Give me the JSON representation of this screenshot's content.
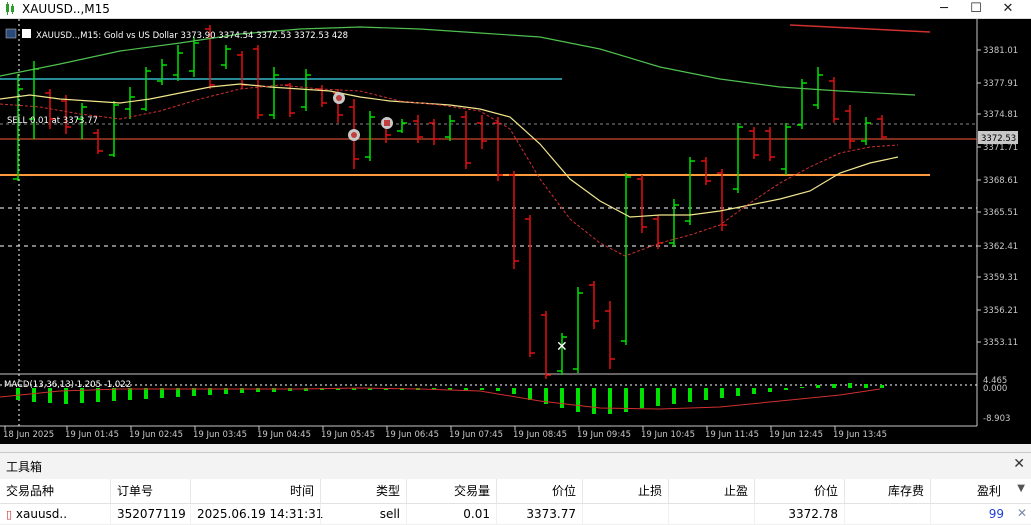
{
  "window": {
    "title": "XAUUSD..,M15",
    "min_icon": "minimize-icon",
    "max_icon": "maximize-icon",
    "close_icon": "close-icon"
  },
  "chart": {
    "info_line": "XAUUSD..,M15:  Gold vs US Dollar  3373.90 3374.54 3372.53 3372.53  428",
    "order_label": "SELL 0.01 at 3373.77",
    "macd_label": "MACD(13,36,13) 1.205 -1.022",
    "bid_price_tag": "3372.53",
    "price_ticks": [
      "3381.01",
      "3377.91",
      "3374.81",
      "3371.71",
      "3368.61",
      "3365.51",
      "3362.41",
      "3359.31",
      "3356.21",
      "3353.11"
    ],
    "macd_ticks": [
      "4.465",
      "0.000",
      "-8.903"
    ],
    "time_ticks": [
      "18 Jun 2025",
      "19 Jun 01:45",
      "19 Jun 02:45",
      "19 Jun 03:45",
      "19 Jun 04:45",
      "19 Jun 05:45",
      "19 Jun 06:45",
      "19 Jun 07:45",
      "19 Jun 08:45",
      "19 Jun 09:45",
      "19 Jun 10:45",
      "19 Jun 11:45",
      "19 Jun 12:45",
      "19 Jun 13:45"
    ],
    "colors": {
      "bull": "#00e000",
      "bear": "#e01010",
      "bg": "#000000",
      "axis": "#c8c8c8",
      "ma_yellow": "#f0e68c",
      "ma_green": "#4fc04f",
      "ma_red": "#d03030",
      "hline_orange": "#ff9a3c",
      "hline_cyan": "#34b8c8"
    }
  },
  "toolbox": {
    "title": "工具箱",
    "close_label": "✕",
    "columns": [
      "交易品种",
      "订单号",
      "时间",
      "类型",
      "交易量",
      "价位",
      "止损",
      "止盈",
      "价位",
      "库存费",
      "盈利"
    ],
    "rows": [
      {
        "symbol": "xauusd..",
        "order": "352077119",
        "time": "2025.06.19 14:31:31",
        "type": "sell",
        "volume": "0.01",
        "price": "3373.77",
        "sl": "",
        "tp": "",
        "cur_price": "3372.78",
        "swap": "",
        "profit": "99"
      }
    ],
    "remove_icon": "close-icon"
  }
}
